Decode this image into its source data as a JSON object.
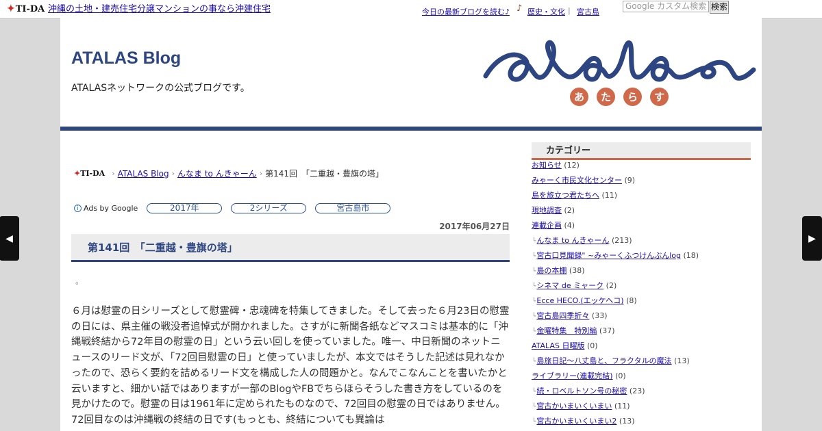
{
  "topbar": {
    "logo": "TI-DA",
    "site_link": "沖縄の土地・建売住宅分譲マンションの事なら沖建住宅",
    "blog_link": "今日の最新ブログを読む♪",
    "history_link": "歴史・文化",
    "separator": "|",
    "miyako_link": "宮古島",
    "search_placeholder": "Google カスタム検索",
    "search_button": "検索"
  },
  "header": {
    "title": "ATALAS Blog",
    "subtitle": "ATALASネットワークの公式ブログです。",
    "logo_kana": [
      "あ",
      "た",
      "ら",
      "す"
    ],
    "brand_color": "#2d4580",
    "accent_color": "#d0694a"
  },
  "breadcrumb": {
    "logo": "TI-DA",
    "items": [
      "ATALAS Blog",
      "んなま to んきゃーん",
      "第141回　「二重越・豊旗の塔」"
    ]
  },
  "ads": {
    "label": "Ads by Google",
    "pills": [
      "2017年",
      "2シリーズ",
      "宮古島市"
    ]
  },
  "post": {
    "date": "2017年06月27日",
    "title": "第141回　「二重越・豊旗の塔」",
    "dot": "。",
    "body": "６月は慰霊の日シリーズとして慰霊碑・忠魂碑を特集してきました。そして去った６月23日の慰霊の日には、県主催の戦没者追悼式が開かれました。さすがに新聞各紙などマスコミは基本的に「沖縄戦終結から72年目の慰霊の日」という云い回しを使っていました。唯一、中日新聞のネットニュースのリード文が、「72回目慰霊の日」と使っていましたが、本文ではそうした記述は見れなかったので、恐らく要約を詰めるリード文を構成した人の問題かと。なんでこなんことを書いたかと云いますと、細かい話ではありますが一部のBlogやFBでちらほらそうした書き方をしているのを見かけたので。慰霊の日は1961年に定められたものなので、72回目の慰霊の日ではありません。72回目なのは沖縄戦の終結の日です(もっとも、終結についても異論は"
  },
  "sidebar": {
    "heading": "カテゴリー",
    "categories": [
      {
        "label": "お知らせ",
        "count": "(12)",
        "child": false
      },
      {
        "label": "みゃーく市民文化センター",
        "count": "(9)",
        "child": false
      },
      {
        "label": "島を旅立つ君たちへ",
        "count": "(11)",
        "child": false
      },
      {
        "label": "現地調査",
        "count": "(2)",
        "child": false
      },
      {
        "label": "連載企画",
        "count": "(4)",
        "child": false
      },
      {
        "label": "んなま to んきゃーん",
        "count": "(213)",
        "child": true
      },
      {
        "label": "宮古口見聞録\" ~みゃーくふつけんぶんlog",
        "count": "(18)",
        "child": true
      },
      {
        "label": "島の本棚",
        "count": "(38)",
        "child": true
      },
      {
        "label": "シネマ de ミャーク",
        "count": "(2)",
        "child": true
      },
      {
        "label": "Ecce HECO.(エッケヘコ)",
        "count": "(8)",
        "child": true
      },
      {
        "label": "宮古島四季折々",
        "count": "(33)",
        "child": true
      },
      {
        "label": "金曜特集　特別編",
        "count": "(37)",
        "child": true
      },
      {
        "label": "ATALAS 日曜版",
        "count": "(0)",
        "child": false
      },
      {
        "label": "島旅日記～八丈島と、フラクタルの魔法",
        "count": "(13)",
        "child": true
      },
      {
        "label": "ライブラリー(連載完結)",
        "count": "(0)",
        "child": false
      },
      {
        "label": "続・ロベルトソン号の秘密",
        "count": "(23)",
        "child": true
      },
      {
        "label": "宮古かいまいくいまい",
        "count": "(11)",
        "child": true
      },
      {
        "label": "宮古かいまいくいまい2",
        "count": "(13)",
        "child": true
      }
    ]
  },
  "nav": {
    "prev_icon": "chevron-left-icon",
    "next_icon": "chevron-right-icon"
  }
}
